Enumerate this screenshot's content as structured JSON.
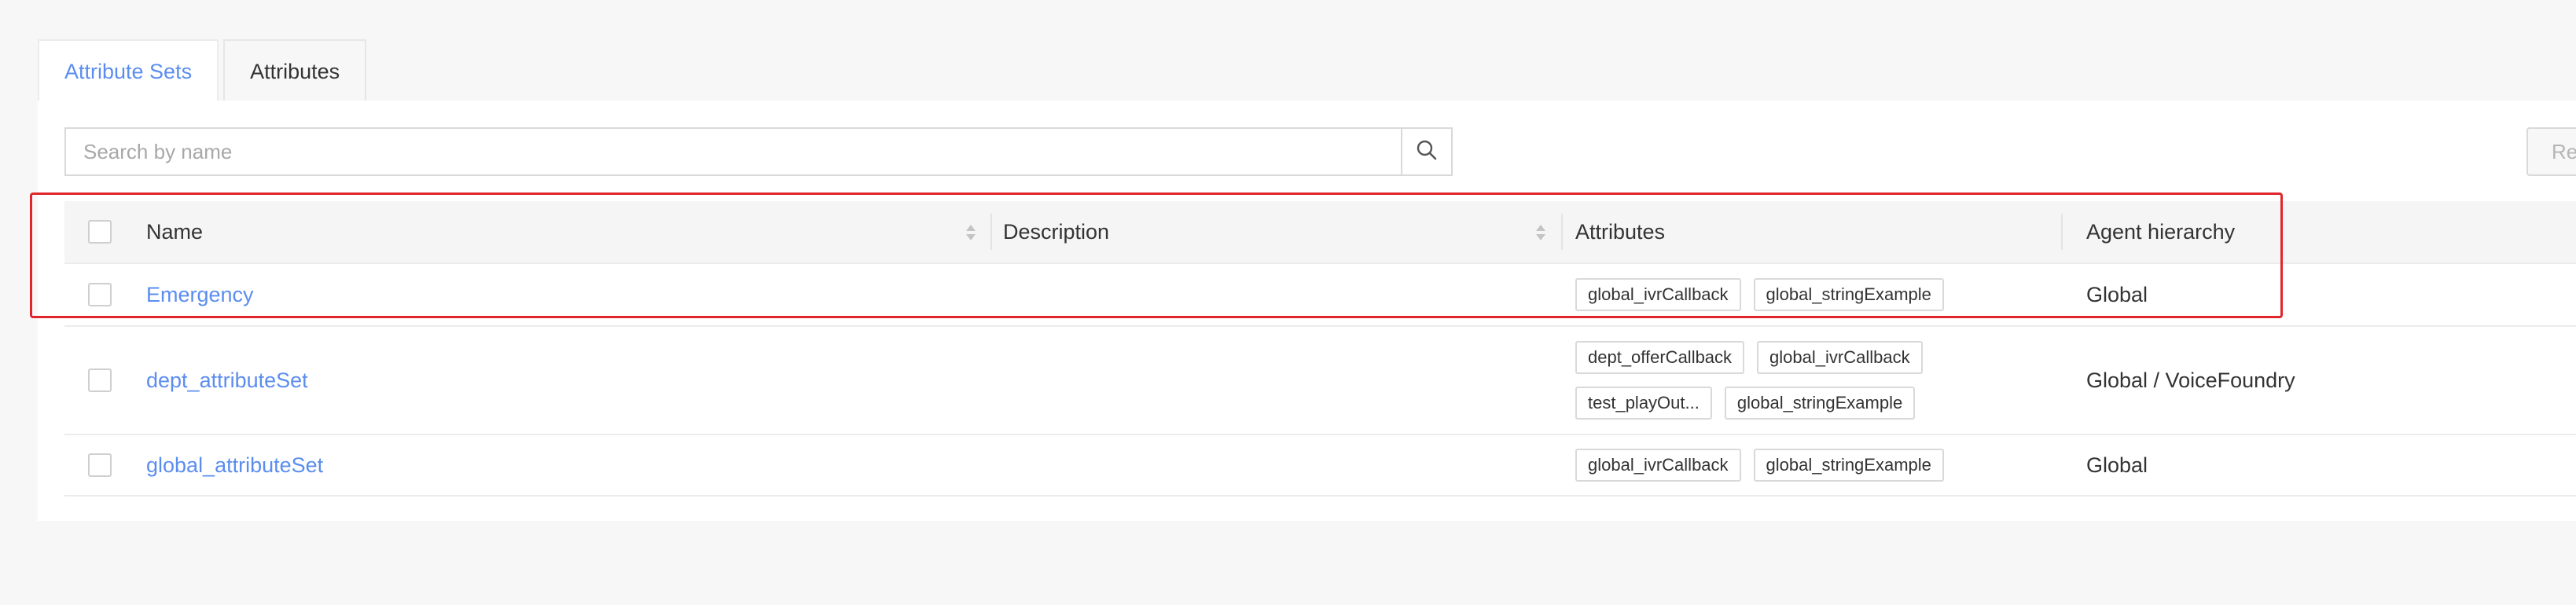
{
  "tabs": [
    {
      "label": "Attribute Sets",
      "active": true
    },
    {
      "label": "Attributes",
      "active": false
    }
  ],
  "search": {
    "placeholder": "Search by name",
    "value": ""
  },
  "right_button": {
    "label": "Re"
  },
  "table": {
    "headers": {
      "name": "Name",
      "description": "Description",
      "attributes": "Attributes",
      "hierarchy": "Agent hierarchy"
    },
    "rows": [
      {
        "name": "Emergency",
        "description": "",
        "attributes": [
          "global_ivrCallback",
          "global_stringExample"
        ],
        "hierarchy": "Global"
      },
      {
        "name": "dept_attributeSet",
        "description": "",
        "attributes": [
          "dept_offerCallback",
          "global_ivrCallback",
          "test_playOut...",
          "global_stringExample"
        ],
        "hierarchy": "Global / VoiceFoundry"
      },
      {
        "name": "global_attributeSet",
        "description": "",
        "attributes": [
          "global_ivrCallback",
          "global_stringExample"
        ],
        "hierarchy": "Global"
      }
    ]
  },
  "colors": {
    "accent": "#5b8def",
    "highlight": "#e0262b",
    "background": "#f7f7f7"
  }
}
